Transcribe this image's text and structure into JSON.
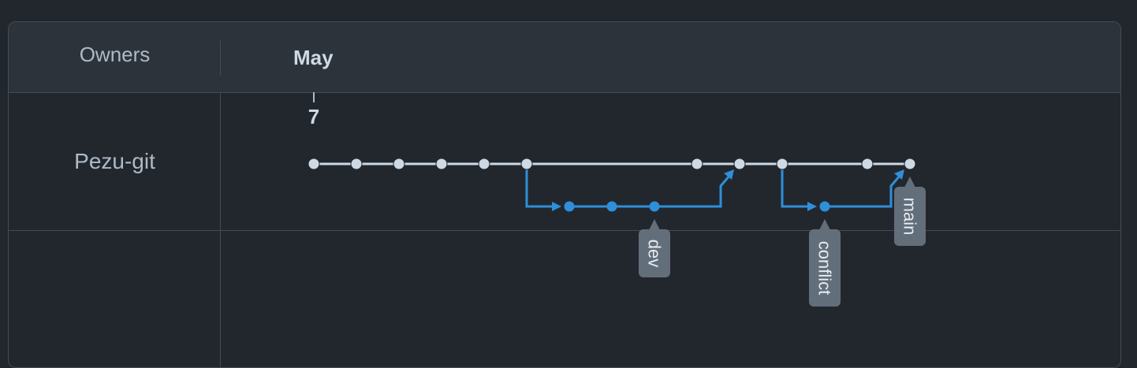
{
  "header": {
    "owners_label": "Owners",
    "month_label": "May"
  },
  "timeline": {
    "day_label": "7"
  },
  "rows": [
    {
      "owner": "Pezu-git"
    }
  ],
  "branches": [
    {
      "name": "dev"
    },
    {
      "name": "conflict"
    },
    {
      "name": "main"
    }
  ],
  "colors": {
    "background": "#22272e",
    "header_bg": "#2d333b",
    "border": "#444c56",
    "main_line": "#cdd9e5",
    "branch_line": "#2f8fd8",
    "tag_bg": "#636e7b",
    "tag_text": "#e6edf3"
  }
}
